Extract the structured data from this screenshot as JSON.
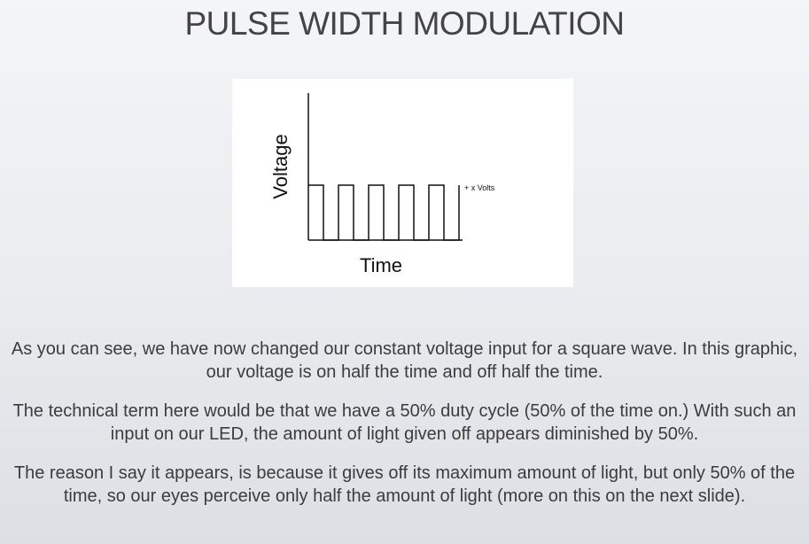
{
  "slide": {
    "title": "PULSE WIDTH MODULATION",
    "paragraphs": [
      "As you can see, we have now changed our constant voltage input for a square wave. In this graphic, our voltage is on half the time and off half the time.",
      "The technical term here would be that we have a 50% duty cycle (50% of the time on.) With such an input on our LED, the amount of light given off appears diminished by 50%.",
      "The reason I say it appears, is because it gives off its maximum amount of light, but only 50% of the time, so our eyes perceive only half the amount of light (more on this on the next slide)."
    ]
  },
  "diagram": {
    "y_axis_label": "Voltage",
    "x_axis_label": "Time",
    "level_label": "+ x Volts",
    "pulse_count": 5,
    "duty_cycle": 0.5,
    "line_color": "#111111"
  }
}
